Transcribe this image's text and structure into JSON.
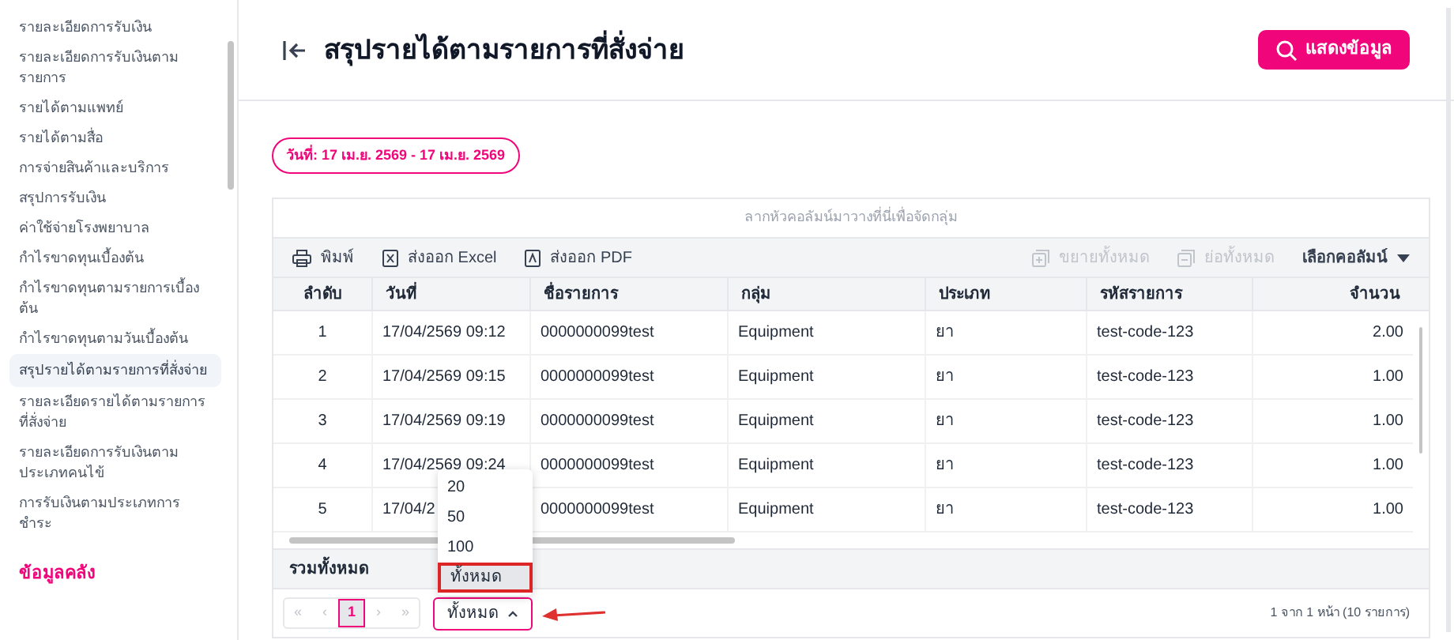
{
  "sidebar": {
    "items": [
      {
        "label": "รายละเอียดการรับเงิน",
        "selected": false
      },
      {
        "label": "รายละเอียดการรับเงินตามรายการ",
        "selected": false
      },
      {
        "label": "รายได้ตามแพทย์",
        "selected": false
      },
      {
        "label": "รายได้ตามสื่อ",
        "selected": false
      },
      {
        "label": "การจ่ายสินค้าและบริการ",
        "selected": false
      },
      {
        "label": "สรุปการรับเงิน",
        "selected": false
      },
      {
        "label": "ค่าใช้จ่ายโรงพยาบาล",
        "selected": false
      },
      {
        "label": "กำไรขาดทุนเบื้องต้น",
        "selected": false
      },
      {
        "label": "กำไรขาดทุนตามรายการเบื้องต้น",
        "selected": false
      },
      {
        "label": "กำไรขาดทุนตามวันเบื้องต้น",
        "selected": false
      },
      {
        "label": "สรุปรายได้ตามรายการที่สั่งจ่าย",
        "selected": true
      },
      {
        "label": "รายละเอียดรายได้ตามรายการที่สั่งจ่าย",
        "selected": false
      },
      {
        "label": "รายละเอียดการรับเงินตามประเภทคนไข้",
        "selected": false
      },
      {
        "label": "การรับเงินตามประเภทการชำระ",
        "selected": false
      }
    ],
    "section": "ข้อมูลคลัง"
  },
  "header": {
    "title": "สรุปรายได้ตามรายการที่สั่งจ่าย",
    "button": "แสดงข้อมูล"
  },
  "date_chip": "วันที่: 17 เม.ย. 2569 - 17 เม.ย. 2569",
  "grid": {
    "group_hint": "ลากหัวคอลัมน์มาวางที่นี่เพื่อจัดกลุ่ม",
    "toolbar": [
      {
        "kind": "print",
        "label": "พิมพ์",
        "disabled": false
      },
      {
        "kind": "excel",
        "label": "ส่งออก Excel",
        "disabled": false
      },
      {
        "kind": "pdf",
        "label": "ส่งออก PDF",
        "disabled": false
      },
      {
        "kind": "expand",
        "label": "ขยายทั้งหมด",
        "disabled": true
      },
      {
        "kind": "collapse",
        "label": "ย่อทั้งหมด",
        "disabled": true
      },
      {
        "kind": "columns",
        "label": "เลือกคอลัมน์",
        "disabled": false
      }
    ],
    "columns": [
      "ลำดับ",
      "วันที่",
      "ชื่อรายการ",
      "กลุ่ม",
      "ประเภท",
      "รหัสรายการ",
      "จำนวน"
    ],
    "rows": [
      [
        "1",
        "17/04/2569 09:12",
        "0000000099test",
        "Equipment",
        "ยา",
        "test-code-123",
        "2.00"
      ],
      [
        "2",
        "17/04/2569 09:15",
        "0000000099test",
        "Equipment",
        "ยา",
        "test-code-123",
        "1.00"
      ],
      [
        "3",
        "17/04/2569 09:19",
        "0000000099test",
        "Equipment",
        "ยา",
        "test-code-123",
        "1.00"
      ],
      [
        "4",
        "17/04/2569 09:24",
        "0000000099test",
        "Equipment",
        "ยา",
        "test-code-123",
        "1.00"
      ],
      [
        "5",
        "17/04/2",
        "0000000099test",
        "Equipment",
        "ยา",
        "test-code-123",
        "1.00"
      ]
    ],
    "total_label": "รวมทั้งหมด",
    "pager": {
      "buttons": [
        {
          "label": "«",
          "selected": false
        },
        {
          "label": "‹",
          "selected": false
        },
        {
          "label": "1",
          "selected": true
        },
        {
          "label": "›",
          "selected": false
        },
        {
          "label": "»",
          "selected": false
        }
      ],
      "page_size": {
        "value": "ทั้งหมด",
        "open": true,
        "options": [
          {
            "label": "20",
            "selected": false
          },
          {
            "label": "50",
            "selected": false
          },
          {
            "label": "100",
            "selected": false
          },
          {
            "label": "ทั้งหมด",
            "selected": true
          }
        ]
      },
      "summary": "1 จาก 1 หน้า (10 รายการ)"
    }
  }
}
